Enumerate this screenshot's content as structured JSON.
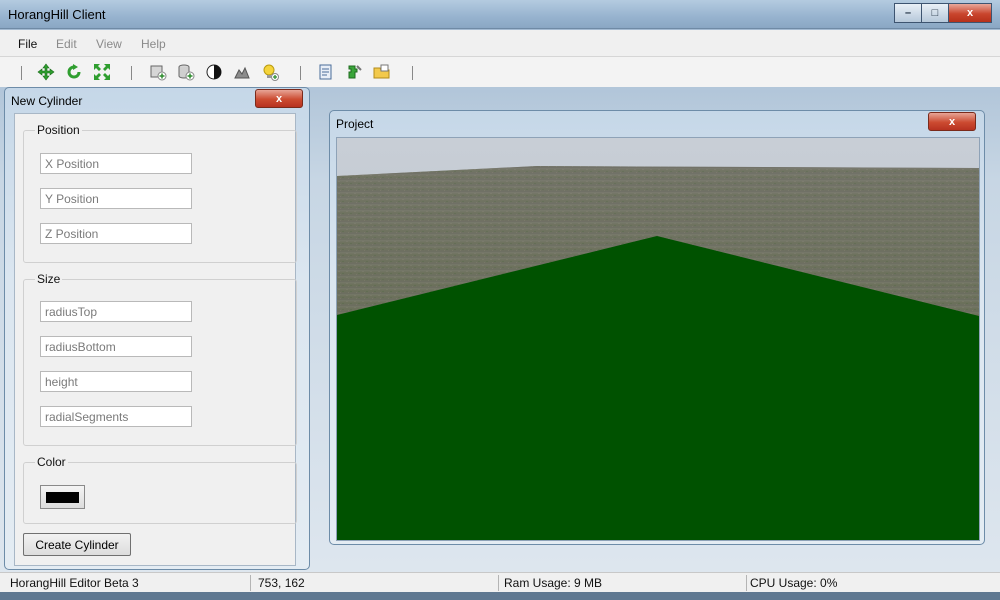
{
  "app": {
    "title": "HorangHill Client"
  },
  "window_controls": {
    "minimize": "–",
    "maximize": "□",
    "close": "x"
  },
  "menu": [
    {
      "label": "File",
      "enabled": true
    },
    {
      "label": "Edit",
      "enabled": false
    },
    {
      "label": "View",
      "enabled": false
    },
    {
      "label": "Help",
      "enabled": false
    }
  ],
  "toolbar": {
    "icons": [
      "move-icon",
      "rotate-icon",
      "scale-icon",
      "add-cube-icon",
      "add-cylinder-icon",
      "material-icon",
      "terrain-icon",
      "light-icon",
      "script-icon",
      "plugin-icon",
      "open-folder-icon"
    ]
  },
  "new_cylinder": {
    "title": "New Cylinder",
    "close_label": "x",
    "position": {
      "legend": "Position",
      "x_placeholder": "X Position",
      "y_placeholder": "Y Position",
      "z_placeholder": "Z Position"
    },
    "size": {
      "legend": "Size",
      "radius_top_placeholder": "radiusTop",
      "radius_bottom_placeholder": "radiusBottom",
      "height_placeholder": "height",
      "radial_segments_placeholder": "radialSegments"
    },
    "color": {
      "legend": "Color",
      "value": "#000000"
    },
    "create_button": "Create Cylinder"
  },
  "project": {
    "title": "Project",
    "close_label": "x",
    "scene_colors": {
      "sky": "#c9d0d8",
      "terrain": "#6d6f5a",
      "plane": "#005200"
    }
  },
  "status": {
    "version": "HorangHill Editor Beta 3",
    "coords": "753, 162",
    "ram": "Ram Usage: 9 MB",
    "cpu": "CPU Usage: 0%"
  }
}
